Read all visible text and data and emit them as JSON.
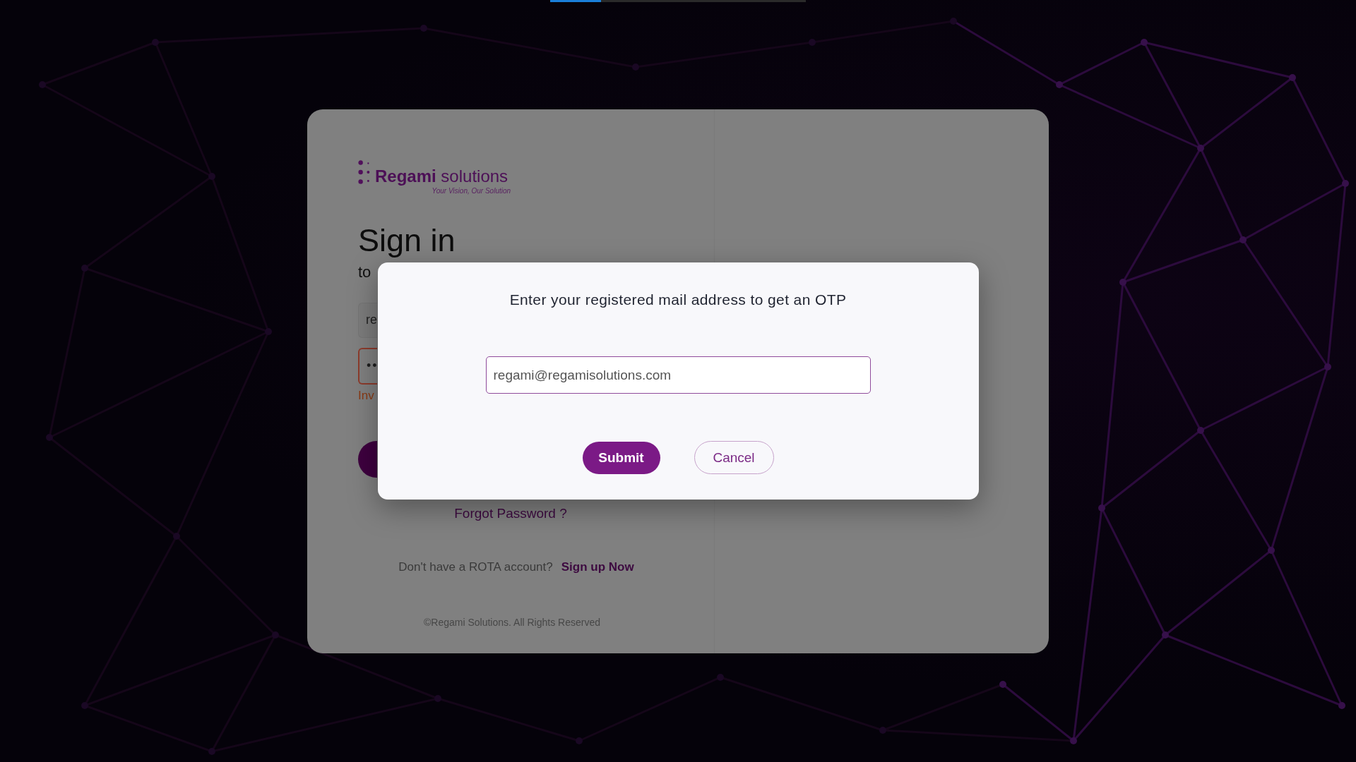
{
  "loading_bar": {
    "level": 0.2
  },
  "sign_in_card": {
    "logo": {
      "name": "**Regami** solutions",
      "tagline": "Your Vision, Our Solution"
    },
    "title": "Sign in",
    "subtitle": "to",
    "fields": [
      {
        "kind": "text",
        "value": "re",
        "invalid": false
      },
      {
        "kind": "password",
        "value": "••",
        "invalid": true
      }
    ],
    "error_message": "Inv",
    "forgot_password_link": "Forgot Password ?",
    "signup_prompt": "Don't have a ROTA account?",
    "signup_link": "Sign up Now",
    "copyright": "©Regami Solutions. All Rights Reserved"
  },
  "dialog": {
    "message": "Enter your registered mail address to get an OTP",
    "email_field": {
      "value": "regami@regamisolutions.com"
    },
    "buttons": [
      {
        "label": "Submit",
        "kind": "primary"
      },
      {
        "label": "Cancel",
        "kind": "secondary"
      }
    ]
  }
}
